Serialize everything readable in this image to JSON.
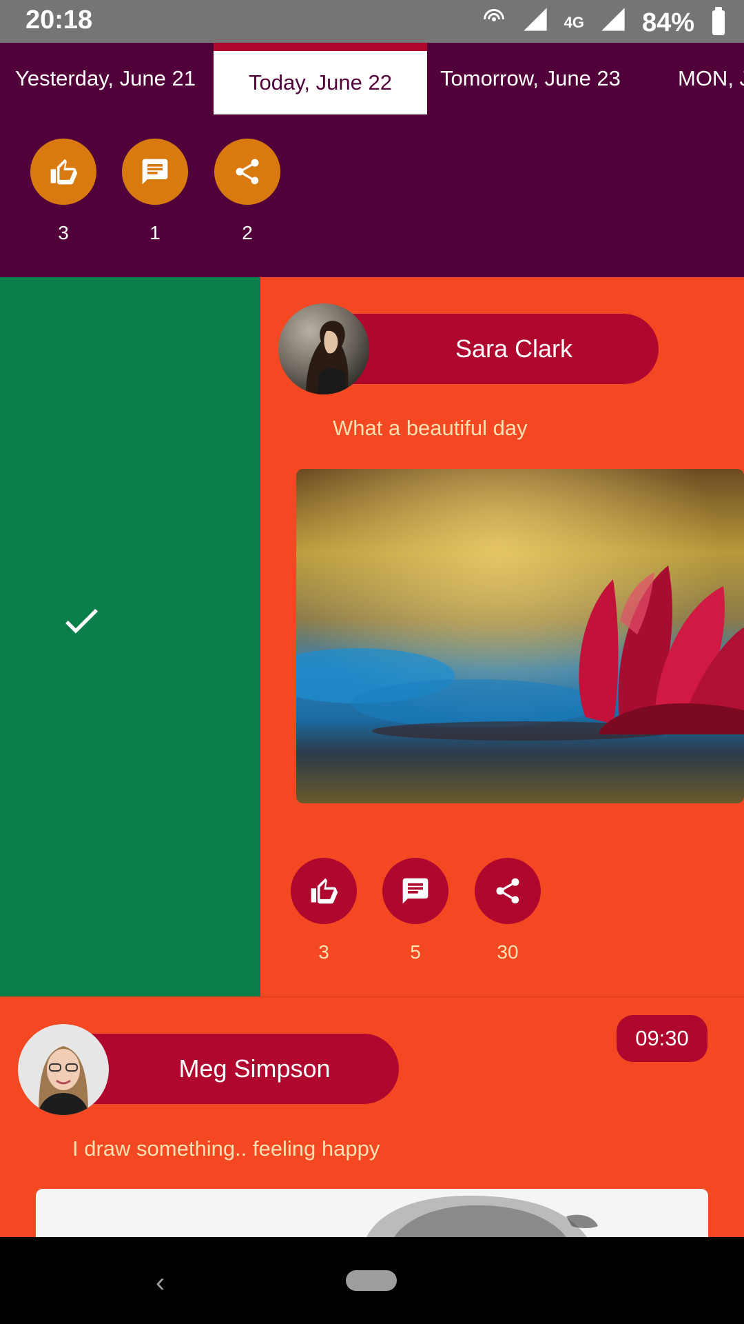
{
  "status_bar": {
    "time": "20:18",
    "network": "4G",
    "battery": "84%"
  },
  "date_tabs": [
    {
      "label": "Yesterday, June 21",
      "active": false
    },
    {
      "label": "Today, June 22",
      "active": true
    },
    {
      "label": "Tomorrow, June 23",
      "active": false
    },
    {
      "label": "MON, J",
      "active": false
    }
  ],
  "header_actions": {
    "like_count": "3",
    "comment_count": "1",
    "share_count": "2"
  },
  "swipe_action": {
    "icon": "check-icon"
  },
  "posts": [
    {
      "author": "Sara Clark",
      "caption": "What a beautiful day",
      "image": "red water lily on blue pond",
      "likes": "3",
      "comments": "5",
      "shares": "30"
    },
    {
      "author": "Meg Simpson",
      "time": "09:30",
      "caption": "I draw something.. feeling happy",
      "image": "pencil drawing of a lion"
    }
  ],
  "colors": {
    "header_bg": "#520039",
    "accent_crimson": "#b0072f",
    "accent_orange": "#d97a10",
    "card_bg": "#f34821",
    "swipe_bg": "#0a7f4b"
  }
}
